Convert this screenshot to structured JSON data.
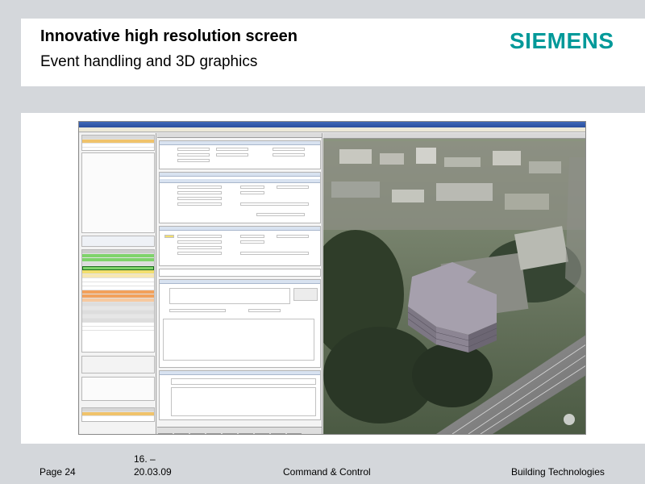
{
  "slide": {
    "title": "Innovative high resolution screen",
    "subtitle": "Event handling and 3D graphics",
    "logo_text": "SIEMENS",
    "colors": {
      "logo": "#009999",
      "band": "#d4d7db",
      "text": "#000000"
    }
  },
  "footer": {
    "page": "Page 24",
    "date_line1": "16. –",
    "date_line2": "20.03.09",
    "center": "Command & Control",
    "right": "Building Technologies"
  },
  "app_screenshot": {
    "description_icon": "embedded-application-screenshot",
    "map_view": "aerial-3d-city-view",
    "highlight_colors": {
      "green": "#7fd36b",
      "orange": "#f2a15b",
      "yellow": "#f3df6e",
      "selection": "#f0c36b"
    }
  }
}
